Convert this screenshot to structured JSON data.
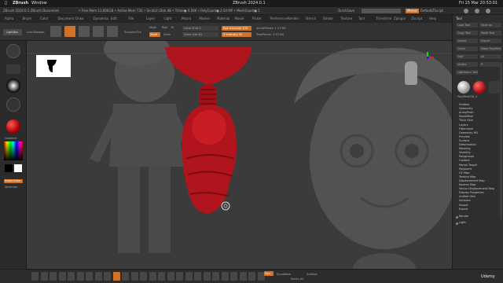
{
  "mac": {
    "apple_icon": "apple-icon",
    "app_name": "ZBrush",
    "menu_window": "Window",
    "window_title": "ZBrush 2024.0.1",
    "clock": "Fri 15 Mar 20:53:01"
  },
  "zbrush_top": {
    "doc_title": "ZBrush 2024.0.1 ZBrush Document",
    "stats": "• Free Mem 13.856GB • Active Mem 735 • Scratch Disk 48 • Timer● 0.046 • PolyCount● 2.54 MP • MeshCount● 1",
    "quicksave": "QuickSave",
    "see_through": "See-through 0",
    "menus_btn": "Menus",
    "default_zscript": "DefaultZScript"
  },
  "menu_bar": [
    "Alpha",
    "Brush",
    "Color",
    "Document",
    "Draw",
    "Dynamics",
    "Edit",
    "File",
    "Layer",
    "Light",
    "Macro",
    "Marker",
    "Material",
    "Movie",
    "Picker",
    "Preferences",
    "Render",
    "Stencil",
    "Stroke",
    "Texture",
    "Tool",
    "Transform",
    "Zplugin",
    "Zscript",
    "Help"
  ],
  "shelf": {
    "lightbox": "LightBox",
    "live_boolean": "Live Boolean",
    "xyz_label": "Sculptris Pro",
    "mrgb": "Mrgb",
    "rgb": "Rgb",
    "m": "M",
    "zadd": "Zadd",
    "zsub": "Zsub",
    "focal_shift": "Focal Shift 0",
    "draw_size": "Draw Size 64",
    "dynamic": "Dynamic",
    "rgb_intensity": "Rgb Intensity 100",
    "z_intensity": "Z Intensity 25",
    "active_points": "ActivePoints: 1.27 Mil",
    "total_points": "TotalPoints: 3.43 Mil"
  },
  "left_shelf": {
    "gradient": "Gradient",
    "switch_color": "SwitchColor",
    "alternate": "Alternate"
  },
  "bottom_shelf": {
    "dynamesh": "DynaMesh",
    "subtool_btn": "SubTool",
    "dyn_label": "Dyn",
    "brand": "Udemy",
    "points": "Points 64"
  },
  "tool_panel": {
    "title": "Tool",
    "buttons": [
      "Load Tool",
      "Save As",
      "Copy Tool",
      "Paste Tool",
      "Import",
      "Export",
      "Clone",
      "Make PolyMesh3D",
      "GoZ",
      "All",
      "Visible",
      "R",
      "Lightbox ▸ Tools"
    ],
    "current_tool": "PolyMesh3D_4",
    "items": [
      "Subtool",
      "Geometry",
      "ArrayMesh",
      "NanoMesh",
      "Thick Skin",
      "Layers",
      "Fibermesh",
      "Geometry HD",
      "Preview",
      "Surface",
      "Deformation",
      "Masking",
      "Visibility",
      "Polygroups",
      "Contact",
      "Morph Target",
      "Polypaint",
      "UV Map",
      "Texture Map",
      "Displacement Map",
      "Normal Map",
      "Vector Displacement Map",
      "Display Properties",
      "Unified Skin",
      "Initialize",
      "Import",
      "Export"
    ],
    "footer": [
      "Render",
      "Light"
    ]
  },
  "canvas": {
    "thumbnail_icon": "silhouette-thumbnail-icon",
    "axis_icon": "xyz-axis-icon"
  },
  "colors": {
    "accent": "#d0722a",
    "sculpt_red": "#b0141c",
    "canvas_bg": "#3b3b3b"
  }
}
